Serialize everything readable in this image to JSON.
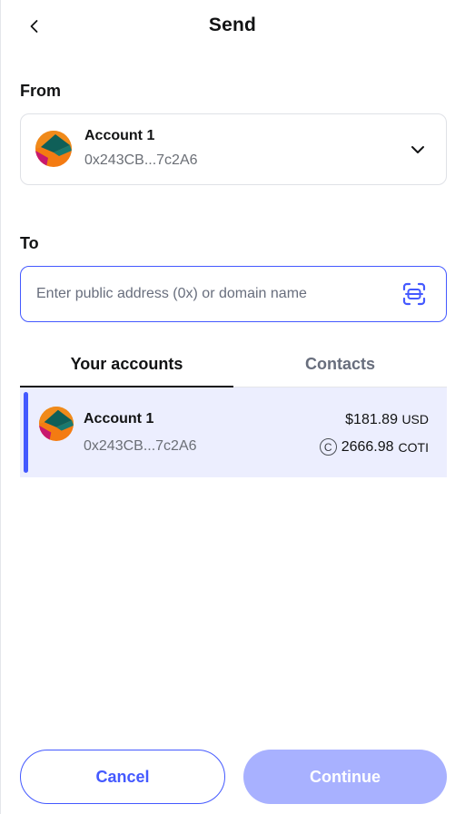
{
  "header": {
    "title": "Send",
    "back_icon": "chevron-left-icon"
  },
  "from": {
    "label": "From",
    "account_name": "Account 1",
    "account_address": "0x243CB...7c2A6",
    "dropdown_icon": "chevron-down-icon"
  },
  "to": {
    "label": "To",
    "input_value": "",
    "placeholder": "Enter public address (0x) or domain name",
    "scan_icon": "qr-scan-icon"
  },
  "tabs": [
    {
      "label": "Your accounts",
      "active": true
    },
    {
      "label": "Contacts",
      "active": false
    }
  ],
  "accounts": [
    {
      "name": "Account 1",
      "address": "0x243CB...7c2A6",
      "fiat_value": "$181.89",
      "fiat_unit": "USD",
      "token_icon": "C",
      "token_value": "2666.98",
      "token_unit": "COTI",
      "selected": true
    }
  ],
  "footer": {
    "cancel_label": "Cancel",
    "continue_label": "Continue",
    "continue_disabled": true
  },
  "colors": {
    "accent": "#4459ff",
    "accent_disabled": "#a8b1ff",
    "row_selected_bg": "#eceefe",
    "muted_text": "#686e7d",
    "border": "#dfe1e6"
  }
}
